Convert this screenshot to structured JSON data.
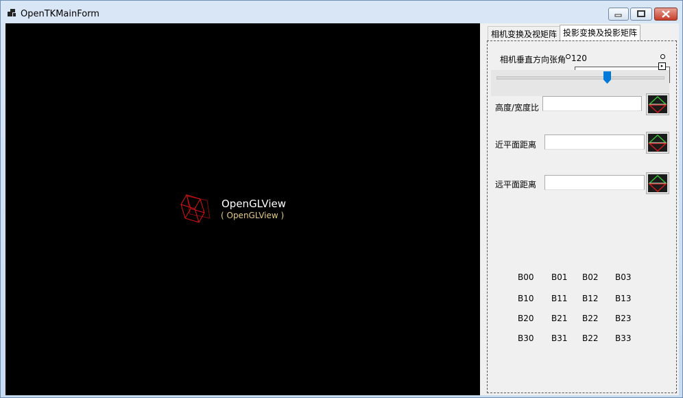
{
  "window": {
    "title": "OpenTKMainForm"
  },
  "gl_view": {
    "name": "OpenGLView",
    "subtitle": "( OpenGLView )"
  },
  "tabs": [
    {
      "label": "相机变换及视矩阵",
      "selected": false
    },
    {
      "label": "投影变换及投影矩阵",
      "selected": true
    }
  ],
  "projection": {
    "fov_label": "相机垂直方向张角",
    "fov_value": "120",
    "fov_slider_fraction": 0.66,
    "aspect_label": "高度/宽度比",
    "aspect_value": "",
    "near_label": "近平面距离",
    "near_value": "",
    "far_label": "远平面距离",
    "far_value": ""
  },
  "matrix": [
    [
      "B00",
      "B01",
      "B02",
      "B03"
    ],
    [
      "B10",
      "B11",
      "B12",
      "B13"
    ],
    [
      "B20",
      "B21",
      "B22",
      "B23"
    ],
    [
      "B30",
      "B31",
      "B22",
      "B33"
    ]
  ],
  "colors": {
    "accent": "#0078d7",
    "title_bar": "#cfdff1",
    "gl_background": "#000000",
    "gl_subtitle": "#e6cc80"
  },
  "icons": [
    "app-icon",
    "minimize-icon",
    "maximize-icon",
    "close-icon",
    "cube-icon",
    "slider-thumb-icon",
    "apply-icon"
  ]
}
